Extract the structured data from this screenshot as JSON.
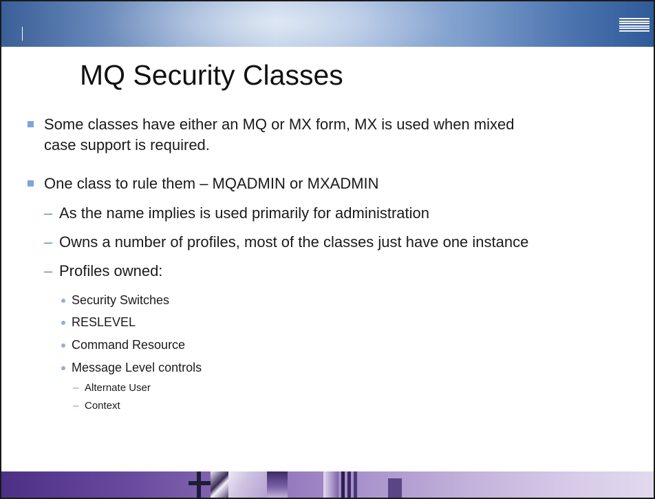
{
  "slide": {
    "title": "MQ Security Classes",
    "logo_text": "IBM",
    "bullets": [
      {
        "text_line1": "Some classes have either an MQ or MX form, MX is used when mixed",
        "text_line2": "case support is required."
      },
      {
        "text": "One class to rule them – MQADMIN or MXADMIN",
        "dash_marker": "–",
        "sub": [
          {
            "text": "As the name implies is used primarily for administration"
          },
          {
            "text": "Owns a number of profiles, most of the classes just have one instance"
          },
          {
            "text": "Profiles owned:",
            "items": [
              {
                "text": "Security Switches"
              },
              {
                "text": "RESLEVEL"
              },
              {
                "text": "Command Resource"
              },
              {
                "text": "Message Level controls",
                "items": [
                  {
                    "text": "Alternate User"
                  },
                  {
                    "text": "Context"
                  }
                ]
              }
            ]
          }
        ]
      }
    ]
  },
  "colors": {
    "header_band": "#5d7fb2",
    "footer_band": "#6a4a9e",
    "bullet_square": "#7ea4d8",
    "bullet_dash": "#6e8fc4",
    "bullet_dot": "#8db0e0",
    "text": "#1a1a1a"
  },
  "icons": {
    "logo": "ibm-logo-icon",
    "level1_marker": "square-bullet-icon",
    "level3_marker": "dot-bullet-icon"
  }
}
